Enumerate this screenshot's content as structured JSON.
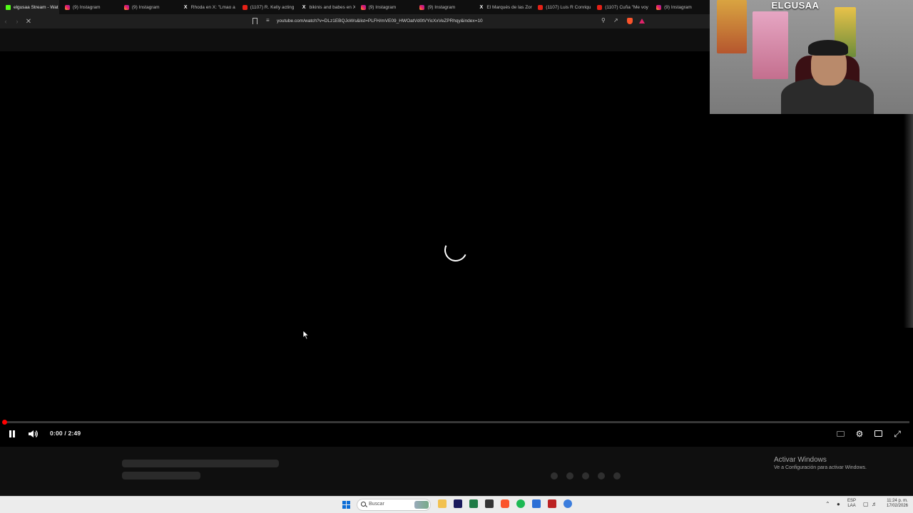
{
  "browser": {
    "tabs": [
      {
        "label": "elgusaa Stream - Wat",
        "favicon": "kick"
      },
      {
        "label": "(9) Instagram",
        "favicon": "ig"
      },
      {
        "label": "(9) Instagram",
        "favicon": "ig"
      },
      {
        "label": "Rhoda en X: \"Lmao a",
        "favicon": "x"
      },
      {
        "label": "(1107) R. Kelly acting",
        "favicon": "yt"
      },
      {
        "label": "bikinis and babes en X",
        "favicon": "x"
      },
      {
        "label": "(9) Instagram",
        "favicon": "ig"
      },
      {
        "label": "(9) Instagram",
        "favicon": "ig"
      },
      {
        "label": "El Marqués de las Zor",
        "favicon": "x"
      },
      {
        "label": "(1107) Luis R Conriqu",
        "favicon": "yt"
      },
      {
        "label": "(1107) Cuña \"Me voy",
        "favicon": "yt"
      },
      {
        "label": "(9) Instagram",
        "favicon": "ig"
      }
    ],
    "url": "youtube.com/watch?v=DLz1EBQJoWs&list=PLFH/mVE09_HWOatVd0tVYicXxVeZPRhqy&index=10",
    "icons": {
      "back": "back-arrow-icon",
      "forward": "forward-arrow-icon",
      "reload": "stop-loading-icon",
      "bookmark": "bookmark-icon",
      "site_info": "site-info-icon",
      "zoom": "zoom-icon",
      "share": "share-icon",
      "shield": "brave-shield-icon",
      "rewards": "brave-rewards-icon"
    }
  },
  "player": {
    "time": "0:00 / 2:49",
    "progress": 0.0,
    "state": "loading",
    "accent": "#ff0000"
  },
  "webcam": {
    "banner": "ELGUSAA"
  },
  "watermark": {
    "title": "Activar Windows",
    "subtitle": "Ve a Configuración para activar Windows."
  },
  "taskbar": {
    "search_placeholder": "Buscar",
    "language": "ESP",
    "language_sub": "LAA",
    "time": "11:24 p. m.",
    "date": "17/02/2026"
  },
  "colors": {
    "youtube_red": "#ff0000",
    "instagram": "#e91e63",
    "kick_green": "#53fc18",
    "brave_orange": "#fb542b",
    "windows_blue": "#0a6cd6"
  }
}
